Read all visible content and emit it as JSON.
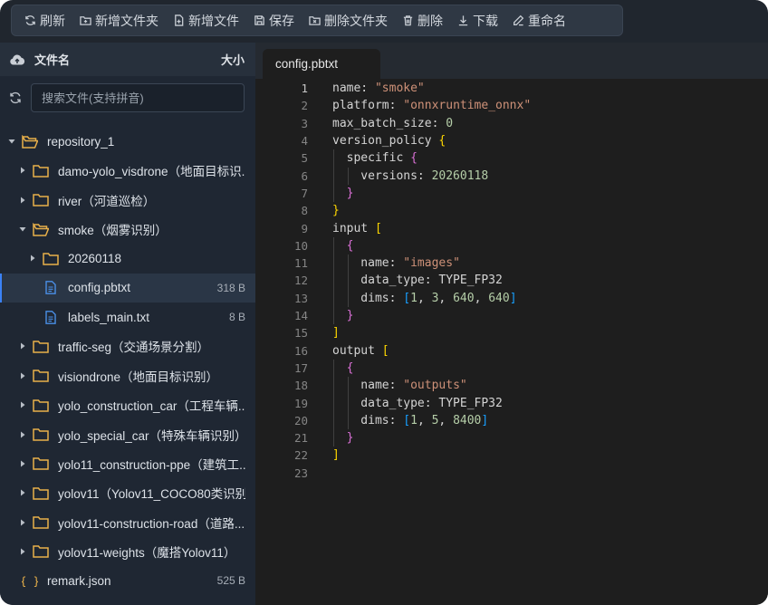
{
  "toolbar": {
    "refresh": "刷新",
    "new_folder": "新增文件夹",
    "new_file": "新增文件",
    "save": "保存",
    "delete_folder": "删除文件夹",
    "delete": "删除",
    "download": "下载",
    "rename": "重命名"
  },
  "sidebar": {
    "header_name": "文件名",
    "header_size": "大小",
    "search_placeholder": "搜索文件(支持拼音)",
    "tree": [
      {
        "name": "repository_1",
        "type": "folder",
        "expanded": true,
        "size": ""
      },
      {
        "name": "damo-yolo_visdrone（地面目标识...",
        "type": "folder",
        "expanded": false,
        "size": ""
      },
      {
        "name": "river（河道巡检）",
        "type": "folder",
        "expanded": false,
        "size": ""
      },
      {
        "name": "smoke（烟雾识别）",
        "type": "folder",
        "expanded": true,
        "size": ""
      },
      {
        "name": "20260118",
        "type": "folder",
        "expanded": false,
        "size": ""
      },
      {
        "name": "config.pbtxt",
        "type": "file",
        "size": "318 B",
        "selected": true
      },
      {
        "name": "labels_main.txt",
        "type": "file",
        "size": "8 B"
      },
      {
        "name": "traffic-seg（交通场景分割）",
        "type": "folder",
        "expanded": false,
        "size": ""
      },
      {
        "name": "visiondrone（地面目标识别）",
        "type": "folder",
        "expanded": false,
        "size": ""
      },
      {
        "name": "yolo_construction_car（工程车辆...",
        "type": "folder",
        "expanded": false,
        "size": ""
      },
      {
        "name": "yolo_special_car（特殊车辆识别）",
        "type": "folder",
        "expanded": false,
        "size": ""
      },
      {
        "name": "yolo11_construction-ppe（建筑工...",
        "type": "folder",
        "expanded": false,
        "size": ""
      },
      {
        "name": "yolov11（Yolov11_COCO80类识别...",
        "type": "folder",
        "expanded": false,
        "size": ""
      },
      {
        "name": "yolov11-construction-road（道路...",
        "type": "folder",
        "expanded": false,
        "size": ""
      },
      {
        "name": "yolov11-weights（魔搭Yolov11）",
        "type": "folder",
        "expanded": false,
        "size": ""
      },
      {
        "name": "remark.json",
        "type": "json",
        "size": "525 B"
      }
    ]
  },
  "editor": {
    "tab_label": "config.pbtxt",
    "active_line": 1,
    "lines": [
      [
        {
          "t": "name: ",
          "c": "k"
        },
        {
          "t": "\"smoke\"",
          "c": "s"
        }
      ],
      [
        {
          "t": "platform: ",
          "c": "k"
        },
        {
          "t": "\"onnxruntime_onnx\"",
          "c": "s"
        }
      ],
      [
        {
          "t": "max_batch_size: ",
          "c": "k"
        },
        {
          "t": "0",
          "c": "n"
        }
      ],
      [
        {
          "t": "version_policy ",
          "c": "k"
        },
        {
          "t": "{",
          "c": "b1"
        }
      ],
      [
        {
          "t": "  specific ",
          "c": "k"
        },
        {
          "t": "{",
          "c": "b2"
        }
      ],
      [
        {
          "t": "    versions: ",
          "c": "k"
        },
        {
          "t": "20260118",
          "c": "n"
        }
      ],
      [
        {
          "t": "  ",
          "c": "k"
        },
        {
          "t": "}",
          "c": "b2"
        }
      ],
      [
        {
          "t": "}",
          "c": "b1"
        }
      ],
      [
        {
          "t": "input ",
          "c": "k"
        },
        {
          "t": "[",
          "c": "b1"
        }
      ],
      [
        {
          "t": "  ",
          "c": "k"
        },
        {
          "t": "{",
          "c": "b2"
        }
      ],
      [
        {
          "t": "    name: ",
          "c": "k"
        },
        {
          "t": "\"images\"",
          "c": "s"
        }
      ],
      [
        {
          "t": "    data_type: TYPE_FP32",
          "c": "k"
        }
      ],
      [
        {
          "t": "    dims: ",
          "c": "k"
        },
        {
          "t": "[",
          "c": "b3"
        },
        {
          "t": "1",
          "c": "n"
        },
        {
          "t": ", ",
          "c": "k"
        },
        {
          "t": "3",
          "c": "n"
        },
        {
          "t": ", ",
          "c": "k"
        },
        {
          "t": "640",
          "c": "n"
        },
        {
          "t": ", ",
          "c": "k"
        },
        {
          "t": "640",
          "c": "n"
        },
        {
          "t": "]",
          "c": "b3"
        }
      ],
      [
        {
          "t": "  ",
          "c": "k"
        },
        {
          "t": "}",
          "c": "b2"
        }
      ],
      [
        {
          "t": "]",
          "c": "b1"
        }
      ],
      [
        {
          "t": "output ",
          "c": "k"
        },
        {
          "t": "[",
          "c": "b1"
        }
      ],
      [
        {
          "t": "  ",
          "c": "k"
        },
        {
          "t": "{",
          "c": "b2"
        }
      ],
      [
        {
          "t": "    name: ",
          "c": "k"
        },
        {
          "t": "\"outputs\"",
          "c": "s"
        }
      ],
      [
        {
          "t": "    data_type: TYPE_FP32",
          "c": "k"
        }
      ],
      [
        {
          "t": "    dims: ",
          "c": "k"
        },
        {
          "t": "[",
          "c": "b3"
        },
        {
          "t": "1",
          "c": "n"
        },
        {
          "t": ", ",
          "c": "k"
        },
        {
          "t": "5",
          "c": "n"
        },
        {
          "t": ", ",
          "c": "k"
        },
        {
          "t": "8400",
          "c": "n"
        },
        {
          "t": "]",
          "c": "b3"
        }
      ],
      [
        {
          "t": "  ",
          "c": "k"
        },
        {
          "t": "}",
          "c": "b2"
        }
      ],
      [
        {
          "t": "]",
          "c": "b1"
        }
      ],
      []
    ]
  }
}
